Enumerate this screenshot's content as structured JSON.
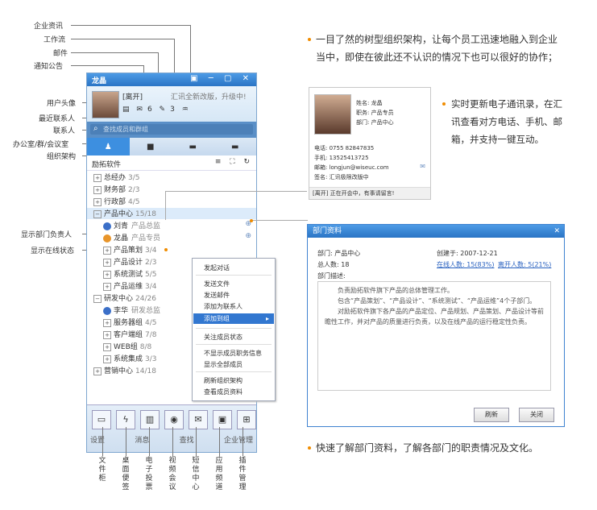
{
  "callouts": {
    "enterprise_news": "企业资讯",
    "workflow": "工作流",
    "mail": "邮件",
    "notice": "通知公告",
    "avatar": "用户头像",
    "recent_contacts": "最近联系人",
    "contacts": "联系人",
    "office_group_meeting": "办公室/群/会议室",
    "org_structure": "组织架构",
    "show_dept_head": "显示部门负责人",
    "show_online_status": "显示在线状态"
  },
  "window": {
    "title": "龙晶",
    "status": "[离开]",
    "motto": "汇讯全新改版，升级中!",
    "badges": [
      "6",
      "3"
    ],
    "search_placeholder": "查找成员和群组",
    "org_title": "励拓软件",
    "tree": [
      {
        "name": "总经办",
        "count": "3/5",
        "level": 0,
        "icon": "plus"
      },
      {
        "name": "财务部",
        "count": "2/3",
        "level": 0,
        "icon": "plus"
      },
      {
        "name": "行政部",
        "count": "4/5",
        "level": 0,
        "icon": "plus"
      },
      {
        "name": "产品中心",
        "count": "15/18",
        "level": 0,
        "icon": "minus"
      },
      {
        "name": "刘青",
        "count": "产品总监",
        "level": 1,
        "icon": "user-blue"
      },
      {
        "name": "龙晶",
        "count": "产品专员",
        "level": 1,
        "icon": "user"
      },
      {
        "name": "产品策划",
        "count": "3/4",
        "level": 1,
        "icon": "plus"
      },
      {
        "name": "产品设计",
        "count": "2/3",
        "level": 1,
        "icon": "plus"
      },
      {
        "name": "系统测试",
        "count": "5/5",
        "level": 1,
        "icon": "plus"
      },
      {
        "name": "产品运维",
        "count": "3/4",
        "level": 1,
        "icon": "plus"
      },
      {
        "name": "研发中心",
        "count": "24/26",
        "level": 0,
        "icon": "minus"
      },
      {
        "name": "李华",
        "count": "研发总监",
        "level": 1,
        "icon": "user-blue"
      },
      {
        "name": "服务器组",
        "count": "4/5",
        "level": 1,
        "icon": "plus"
      },
      {
        "name": "客户端组",
        "count": "7/8",
        "level": 1,
        "icon": "plus"
      },
      {
        "name": "WEB组",
        "count": "8/8",
        "level": 1,
        "icon": "plus"
      },
      {
        "name": "系统集成",
        "count": "3/3",
        "level": 1,
        "icon": "plus"
      },
      {
        "name": "营销中心",
        "count": "14/18",
        "level": 0,
        "icon": "plus"
      }
    ],
    "bottom_bar": [
      "设置",
      "消息",
      "查找",
      "企业管理"
    ]
  },
  "context_menu": [
    "发起对话",
    "发送文件",
    "发送邮件",
    "添加为联系人",
    "添加到组",
    "关注成员状态",
    "不显示成员职务信息",
    "显示全部成员",
    "刷新组织架构",
    "查看成员资料"
  ],
  "card": {
    "name_label": "姓名: 龙晶",
    "title_label": "职务: 产品专员",
    "dept_label": "部门: 产品中心",
    "phone": "电话: 0755 82847835",
    "mobile": "手机: 13525413725",
    "email": "邮箱: longjun@wiseuc.com",
    "sign": "签名: 汇讯极限改版中",
    "footer": "[离开] 正在开会中，有事请留言!"
  },
  "dept_dialog": {
    "title": "部门资料",
    "dept": "部门: 产品中心",
    "created": "创建于: 2007-12-21",
    "total": "总人数: 18",
    "online": "在线人数: 15(83%)",
    "away": "离开人数: 5(21%)",
    "desc_label": "部门描述:",
    "desc": [
      "负责励拓软件旗下产品的总体管理工作。",
      "包含“产品策划”、“产品设计”、“系统测试”、“产品运维”4个子部门。",
      "对励拓软件旗下各产品的产品定位、产品规划、产品策划、产品设计等前瞻性工作，并对产品的质量进行负责，以及在线产品的运行稳定性负责。"
    ],
    "btn_refresh": "刷新",
    "btn_close": "关闭"
  },
  "bottom_labels": [
    "文件柜",
    "桌面便签",
    "电子投票",
    "视频会议",
    "短信中心",
    "应用频道",
    "插件管理"
  ],
  "paragraphs": {
    "p1a": "一目了然的树型组织架构，让每个员工迅速地融入到企业",
    "p1b": "当中，即使在彼此还不认识的情况下也可以很好的协作；",
    "p2a": "实时更新电子通讯录，在汇",
    "p2b": "讯查看对方电话、手机、邮",
    "p2c": "箱，并支持一键互动。",
    "p3": "快速了解部门资料，了解各部门的职责情况及文化。"
  }
}
